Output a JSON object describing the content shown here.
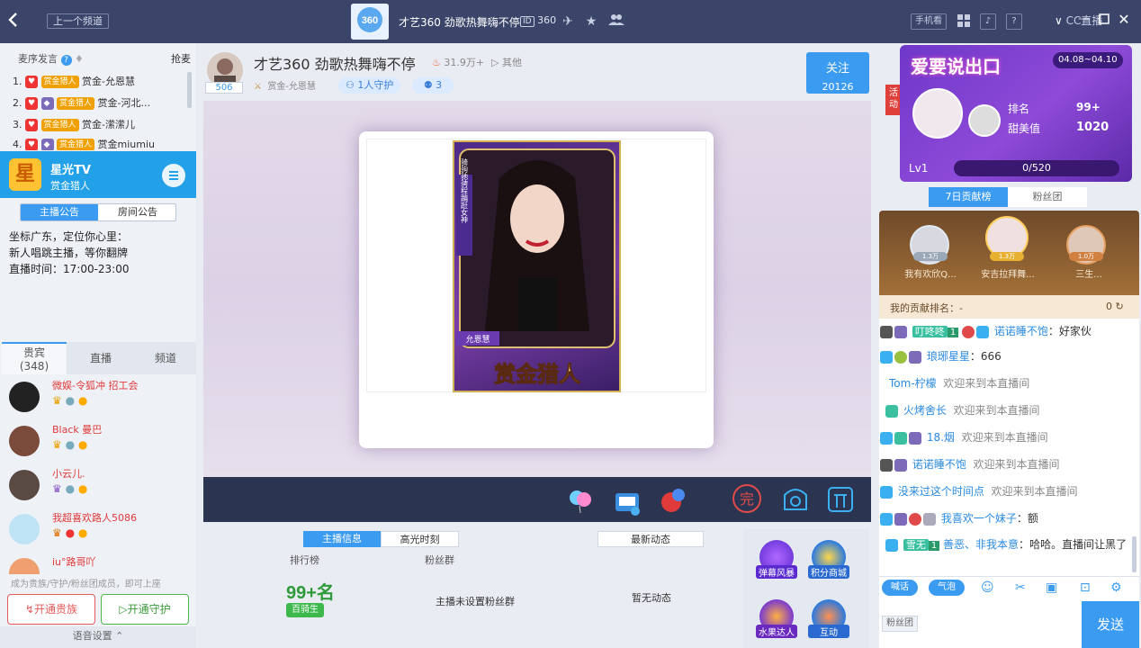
{
  "topbar": {
    "prev_channel": "上一个频道",
    "title": "才艺360 劲歌热舞嗨不停",
    "room_id": "360",
    "phone_watch": "手机看",
    "cc_logo": "CC直播"
  },
  "left": {
    "ranking": {
      "title": "麦序发言",
      "grab": "抢麦",
      "rows": [
        {
          "n": "1.",
          "name": "赏金-允恩慧"
        },
        {
          "n": "2.",
          "name": "赏金-河北..."
        },
        {
          "n": "3.",
          "name": "赏金-潆潆儿"
        },
        {
          "n": "4.",
          "name": "赏金miumiu"
        }
      ],
      "badge_text": "赏金猎人"
    },
    "anchor": {
      "name": "星光TV",
      "sub": "赏金猎人",
      "logo_char": "星"
    },
    "notice_tabs": [
      "主播公告",
      "房间公告"
    ],
    "notice_lines": [
      "坐标广东，定位你心里：",
      "新人唱跳主播，等你翻牌",
      "直播时间：17:00-23:00"
    ],
    "viewer_tabs": {
      "vip": "贵宾",
      "vip_count": "(348)",
      "live": "直播",
      "channel": "频道"
    },
    "viewers": [
      {
        "name": "微娱-令狐冲 招工会"
      },
      {
        "name": "Black 曼巴"
      },
      {
        "name": "小云儿."
      },
      {
        "name": "我超喜欢路人5086"
      },
      {
        "name": "iu°路哥吖"
      }
    ],
    "hint": "成为贵族/守护/粉丝团成员，即可上座",
    "open_noble": "开通贵族",
    "open_guard": "开通守护",
    "voice_settings": "语音设置"
  },
  "stream": {
    "title": "才艺360 劲歌热舞嗨不停",
    "heat": "31.9万+",
    "more": "其他",
    "avatar_num": "506",
    "host_name": "赏金-允恩慧",
    "guard": "1人守护",
    "fans": "3",
    "follow": "关注",
    "follow_count": "20126",
    "poster_name": "允恩慧",
    "poster_title": "赏金猎人",
    "poster_side": "骑驹驰骋程蹁跹女神"
  },
  "info": {
    "tabs": [
      "主播信息",
      "高光时刻"
    ],
    "news_tab": "最新动态",
    "rank_label": "排行榜",
    "fans_label": "粉丝群",
    "rank_value": "99+名",
    "rank_badge": "百骑生",
    "no_group": "主播未设置粉丝群",
    "no_news": "暂无动态",
    "apps": [
      "弹幕风暴",
      "积分商城",
      "水果达人",
      "互动"
    ]
  },
  "right": {
    "banner_title": "爱要说出口",
    "date": "04.08~04.10",
    "rank_label": "排名",
    "rank_value": "99+",
    "sweet_label": "甜美值",
    "sweet_value": "1020",
    "level": "Lv1",
    "progress": "0/520",
    "progress_fraction": 0,
    "tabs": [
      "7日贡献榜",
      "粉丝团"
    ],
    "podium": [
      {
        "val": "1.3万",
        "name": "我有欢欣Q..."
      },
      {
        "val": "1.3万",
        "name": "安吉拉拜舞..."
      },
      {
        "val": "1.0万",
        "name": "三生..."
      }
    ],
    "my_rank": "我的贡献排名：-",
    "my_rank_val": "0",
    "chat": [
      {
        "user": "叮咚咚",
        "lvl": "1",
        "user2": "诺诺睡不饱",
        "msg": "好家伙"
      },
      {
        "user": "琅琊星星",
        "msg": "666"
      },
      {
        "user": "Tom-柠檬",
        "msg": "欢迎来到本直播间"
      },
      {
        "user": "火烤舍长",
        "msg": "欢迎来到本直播间"
      },
      {
        "user": "18.烟",
        "msg": "欢迎来到本直播间"
      },
      {
        "user": "诺诺睡不饱",
        "msg": "欢迎来到本直播间"
      },
      {
        "user": "没来过这个时间点",
        "msg": "欢迎来到本直播间"
      },
      {
        "user": "我喜欢一个妹子",
        "msg": "额"
      },
      {
        "user": "雪无",
        "lvl": "1",
        "user2": "善恶、非我本意",
        "msg": "哈哈。直播间让黑了"
      }
    ],
    "speak": "喊话",
    "bubble": "气泡",
    "fan_group": "粉丝团",
    "send": "发送",
    "side_tag": "活动"
  },
  "colors": {
    "topbar": "#3a4569",
    "accent": "#3b9bf0",
    "anchor": "#22a0e8"
  }
}
